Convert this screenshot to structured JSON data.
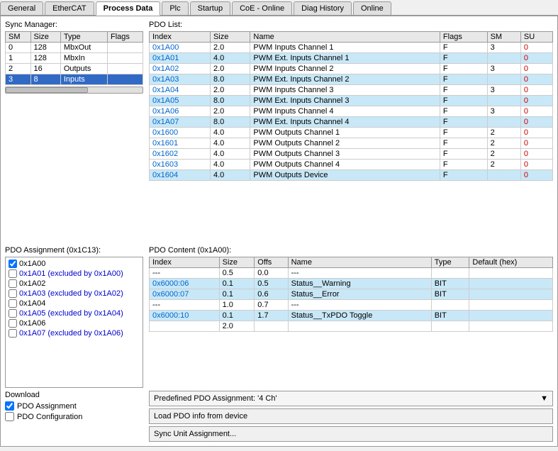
{
  "tabs": [
    {
      "label": "General",
      "active": false
    },
    {
      "label": "EtherCAT",
      "active": false
    },
    {
      "label": "Process Data",
      "active": true
    },
    {
      "label": "Plc",
      "active": false
    },
    {
      "label": "Startup",
      "active": false
    },
    {
      "label": "CoE - Online",
      "active": false
    },
    {
      "label": "Diag History",
      "active": false
    },
    {
      "label": "Online",
      "active": false
    }
  ],
  "sync_manager": {
    "label": "Sync Manager:",
    "columns": [
      "SM",
      "Size",
      "Type",
      "Flags"
    ],
    "rows": [
      {
        "sm": "0",
        "size": "128",
        "type": "MbxOut",
        "flags": "",
        "selected": false
      },
      {
        "sm": "1",
        "size": "128",
        "type": "MbxIn",
        "flags": "",
        "selected": false
      },
      {
        "sm": "2",
        "size": "16",
        "type": "Outputs",
        "flags": "",
        "selected": false
      },
      {
        "sm": "3",
        "size": "8",
        "type": "Inputs",
        "flags": "",
        "selected": true
      }
    ]
  },
  "pdo_list": {
    "label": "PDO List:",
    "columns": [
      "Index",
      "Size",
      "Name",
      "Flags",
      "SM",
      "SU"
    ],
    "rows": [
      {
        "index": "0x1A00",
        "size": "2.0",
        "name": "PWM Inputs Channel 1",
        "flags": "F",
        "sm": "3",
        "su": "0",
        "style": "normal"
      },
      {
        "index": "0x1A01",
        "size": "4.0",
        "name": "PWM Ext. Inputs Channel 1",
        "flags": "F",
        "sm": "",
        "su": "0",
        "style": "blue"
      },
      {
        "index": "0x1A02",
        "size": "2.0",
        "name": "PWM Inputs Channel 2",
        "flags": "F",
        "sm": "3",
        "su": "0",
        "style": "normal"
      },
      {
        "index": "0x1A03",
        "size": "8.0",
        "name": "PWM Ext. Inputs Channel 2",
        "flags": "F",
        "sm": "",
        "su": "0",
        "style": "blue"
      },
      {
        "index": "0x1A04",
        "size": "2.0",
        "name": "PWM Inputs Channel 3",
        "flags": "F",
        "sm": "3",
        "su": "0",
        "style": "normal"
      },
      {
        "index": "0x1A05",
        "size": "8.0",
        "name": "PWM Ext. Inputs Channel 3",
        "flags": "F",
        "sm": "",
        "su": "0",
        "style": "blue"
      },
      {
        "index": "0x1A06",
        "size": "2.0",
        "name": "PWM Inputs Channel 4",
        "flags": "F",
        "sm": "3",
        "su": "0",
        "style": "normal"
      },
      {
        "index": "0x1A07",
        "size": "8.0",
        "name": "PWM Ext. Inputs Channel 4",
        "flags": "F",
        "sm": "",
        "su": "0",
        "style": "blue"
      },
      {
        "index": "0x1600",
        "size": "4.0",
        "name": "PWM Outputs Channel 1",
        "flags": "F",
        "sm": "2",
        "su": "0",
        "style": "normal"
      },
      {
        "index": "0x1601",
        "size": "4.0",
        "name": "PWM Outputs Channel 2",
        "flags": "F",
        "sm": "2",
        "su": "0",
        "style": "normal"
      },
      {
        "index": "0x1602",
        "size": "4.0",
        "name": "PWM Outputs Channel 3",
        "flags": "F",
        "sm": "2",
        "su": "0",
        "style": "normal"
      },
      {
        "index": "0x1603",
        "size": "4.0",
        "name": "PWM Outputs Channel 4",
        "flags": "F",
        "sm": "2",
        "su": "0",
        "style": "normal"
      },
      {
        "index": "0x1604",
        "size": "4.0",
        "name": "PWM Outputs Device",
        "flags": "F",
        "sm": "",
        "su": "0",
        "style": "blue"
      }
    ]
  },
  "pdo_assignment": {
    "label": "PDO Assignment (0x1C13):",
    "items": [
      {
        "label": "0x1A00",
        "checked": true,
        "excluded": false
      },
      {
        "label": "0x1A01 (excluded by 0x1A00)",
        "checked": false,
        "excluded": true
      },
      {
        "label": "0x1A02",
        "checked": false,
        "excluded": false
      },
      {
        "label": "0x1A03 (excluded by 0x1A02)",
        "checked": false,
        "excluded": true
      },
      {
        "label": "0x1A04",
        "checked": false,
        "excluded": false
      },
      {
        "label": "0x1A05 (excluded by 0x1A04)",
        "checked": false,
        "excluded": true
      },
      {
        "label": "0x1A06",
        "checked": false,
        "excluded": false
      },
      {
        "label": "0x1A07 (excluded by 0x1A06)",
        "checked": false,
        "excluded": true
      }
    ]
  },
  "pdo_content": {
    "label": "PDO Content (0x1A00):",
    "columns": [
      "Index",
      "Size",
      "Offs",
      "Name",
      "Type",
      "Default (hex)"
    ],
    "rows": [
      {
        "index": "---",
        "size": "0.5",
        "offs": "0.0",
        "name": "---",
        "type": "",
        "default": "",
        "style": "normal"
      },
      {
        "index": "0x6000:06",
        "size": "0.1",
        "offs": "0.5",
        "name": "Status__Warning",
        "type": "BIT",
        "default": "",
        "style": "blue"
      },
      {
        "index": "0x6000:07",
        "size": "0.1",
        "offs": "0.6",
        "name": "Status__Error",
        "type": "BIT",
        "default": "",
        "style": "blue"
      },
      {
        "index": "---",
        "size": "1.0",
        "offs": "0.7",
        "name": "---",
        "type": "",
        "default": "",
        "style": "normal"
      },
      {
        "index": "0x6000:10",
        "size": "0.1",
        "offs": "1.7",
        "name": "Status__TxPDO Toggle",
        "type": "BIT",
        "default": "",
        "style": "blue"
      },
      {
        "index": "",
        "size": "2.0",
        "offs": "",
        "name": "",
        "type": "",
        "default": "",
        "style": "empty"
      }
    ]
  },
  "download": {
    "label": "Download",
    "items": [
      {
        "label": "PDO Assignment",
        "checked": true
      },
      {
        "label": "PDO Configuration",
        "checked": false
      }
    ]
  },
  "footer": {
    "predefined_label": "Predefined PDO Assignment: '4 Ch'",
    "load_button": "Load PDO info from device",
    "sync_button": "Sync Unit Assignment..."
  }
}
